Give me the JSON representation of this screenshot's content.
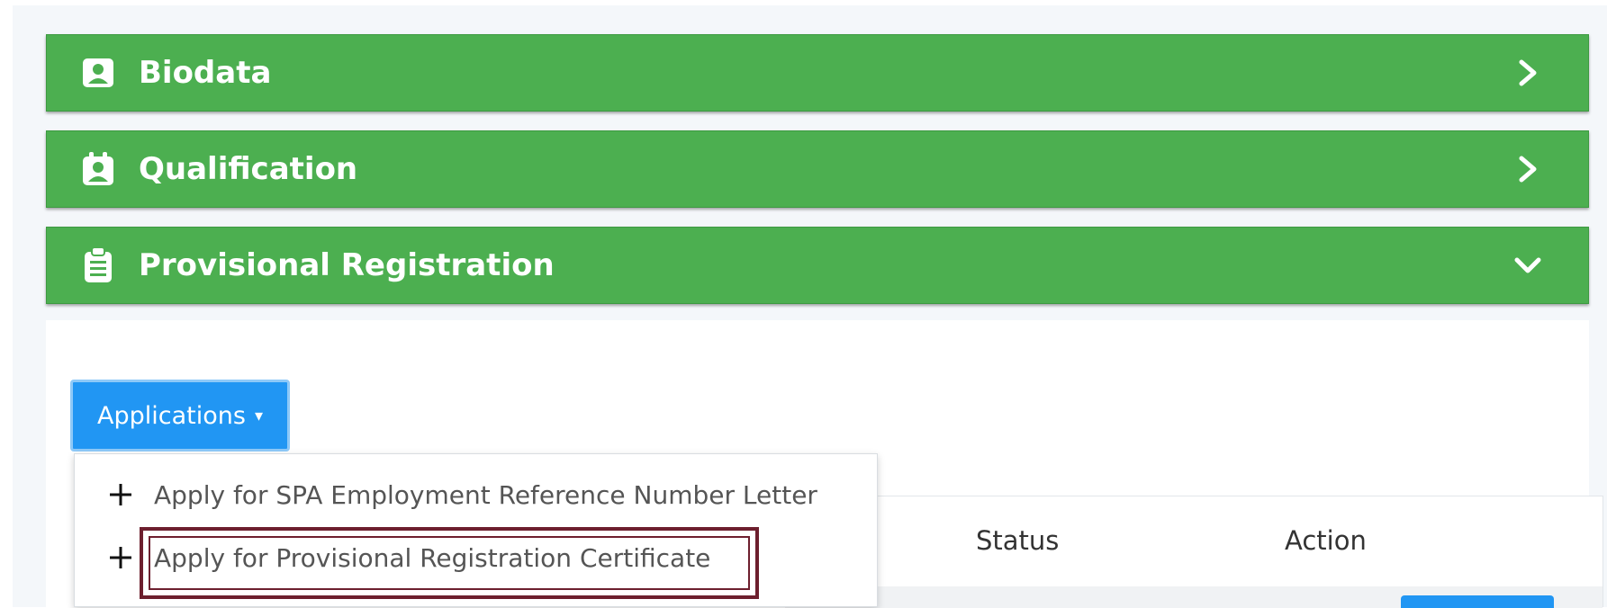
{
  "panels": [
    {
      "title": "Biodata",
      "icon": "id-badge-icon",
      "state": "collapsed"
    },
    {
      "title": "Qualification",
      "icon": "certificate-icon",
      "state": "collapsed"
    },
    {
      "title": "Provisional Registration",
      "icon": "clipboard-icon",
      "state": "expanded"
    }
  ],
  "applications_button": {
    "label": "Applications",
    "caret": "▾"
  },
  "dropdown": {
    "items": [
      {
        "label": "Apply for SPA Employment Reference Number Letter",
        "icon": "plus-icon"
      },
      {
        "label": "Apply for Provisional Registration Certificate",
        "icon": "plus-icon",
        "highlighted": true
      }
    ]
  },
  "table": {
    "sort_indicator": "⇅",
    "columns": [
      "Status",
      "Action"
    ]
  },
  "colors": {
    "panel_green": "#4caf50",
    "button_blue": "#2196f3",
    "highlight": "#6d1f2e"
  }
}
